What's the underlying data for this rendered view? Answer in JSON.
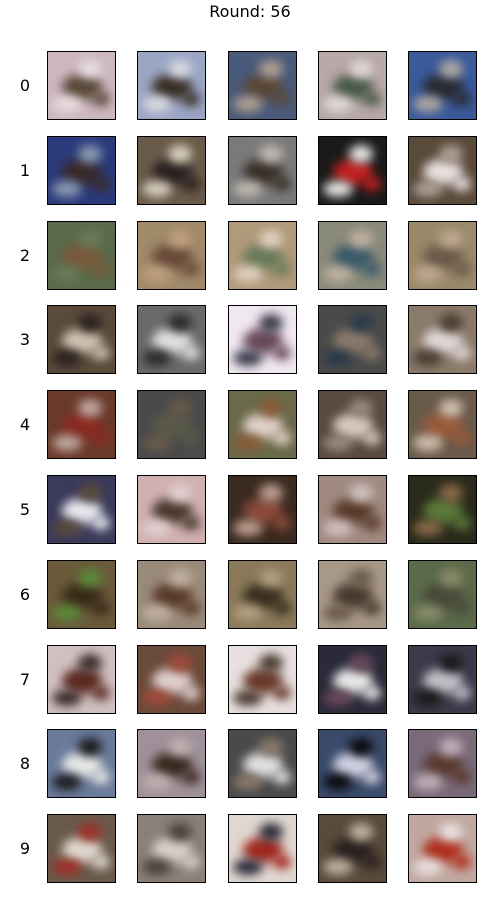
{
  "title": "Round: 56",
  "row_labels": [
    "0",
    "1",
    "2",
    "3",
    "4",
    "5",
    "6",
    "7",
    "8",
    "9"
  ],
  "grid": {
    "rows": 10,
    "cols": 5
  },
  "tiles": [
    [
      {
        "bg": "#cdb8c0",
        "fg": "#5a4a3a",
        "accent": "#e8dde0"
      },
      {
        "bg": "#9aa6c4",
        "fg": "#3a3028",
        "accent": "#d8d8e0"
      },
      {
        "bg": "#4a5a7a",
        "fg": "#5a4838",
        "accent": "#b0a090"
      },
      {
        "bg": "#b8a8a8",
        "fg": "#4a5a48",
        "accent": "#e0d8d8"
      },
      {
        "bg": "#3a5a9a",
        "fg": "#2a2a30",
        "accent": "#b0a8a0"
      }
    ],
    [
      {
        "bg": "#2a3a7a",
        "fg": "#3a2a2a",
        "accent": "#8a9ab0"
      },
      {
        "bg": "#6a5a4a",
        "fg": "#2a2020",
        "accent": "#d8d0c0"
      },
      {
        "bg": "#7a7a7a",
        "fg": "#3a3028",
        "accent": "#c0b8b0"
      },
      {
        "bg": "#1a1a1a",
        "fg": "#c02020",
        "accent": "#e8e8e8"
      },
      {
        "bg": "#5a4a3a",
        "fg": "#e8e0e0",
        "accent": "#b0a098"
      }
    ],
    [
      {
        "bg": "#5a6a4a",
        "fg": "#7a5a3a",
        "accent": "#6a7a5a"
      },
      {
        "bg": "#a08a6a",
        "fg": "#6a4a3a",
        "accent": "#c0a080"
      },
      {
        "bg": "#b09a7a",
        "fg": "#6a7a5a",
        "accent": "#e0d0c0"
      },
      {
        "bg": "#8a8a7a",
        "fg": "#3a5a6a",
        "accent": "#c0b0a0"
      },
      {
        "bg": "#9a8a6a",
        "fg": "#6a5a4a",
        "accent": "#c0a890"
      }
    ],
    [
      {
        "bg": "#5a4a3a",
        "fg": "#d0c0b0",
        "accent": "#2a2020"
      },
      {
        "bg": "#6a6a6a",
        "fg": "#e0e0e0",
        "accent": "#2a2a2a"
      },
      {
        "bg": "#f0e8f0",
        "fg": "#6a4a5a",
        "accent": "#3a3a4a"
      },
      {
        "bg": "#4a4a4a",
        "fg": "#8a7a6a",
        "accent": "#2a3a4a"
      },
      {
        "bg": "#8a7a6a",
        "fg": "#e0d8d8",
        "accent": "#4a3a30"
      }
    ],
    [
      {
        "bg": "#6a3a2a",
        "fg": "#8a2a20",
        "accent": "#c0a8a0"
      },
      {
        "bg": "#4a4a4a",
        "fg": "#5a5a4a",
        "accent": "#6a5a4a"
      },
      {
        "bg": "#6a6a4a",
        "fg": "#e0d0c8",
        "accent": "#8a5a3a"
      },
      {
        "bg": "#5a4a40",
        "fg": "#d8c8c0",
        "accent": "#9a8a80"
      },
      {
        "bg": "#6a5a4a",
        "fg": "#9a5a3a",
        "accent": "#d0c0b0"
      }
    ],
    [
      {
        "bg": "#3a3a5a",
        "fg": "#e8e8f0",
        "accent": "#5a4a3a"
      },
      {
        "bg": "#d0b0b0",
        "fg": "#4a3a30",
        "accent": "#e0d0d0"
      },
      {
        "bg": "#3a2a20",
        "fg": "#8a4a3a",
        "accent": "#c0a090"
      },
      {
        "bg": "#a08a80",
        "fg": "#5a3a2a",
        "accent": "#d0c0c0"
      },
      {
        "bg": "#2a2a1a",
        "fg": "#5a7a3a",
        "accent": "#8a6a4a"
      }
    ],
    [
      {
        "bg": "#6a5a3a",
        "fg": "#3a2a1a",
        "accent": "#5a8a3a"
      },
      {
        "bg": "#9a8a7a",
        "fg": "#5a3a2a",
        "accent": "#c0b0a0"
      },
      {
        "bg": "#8a7a5a",
        "fg": "#3a3020",
        "accent": "#b0a080"
      },
      {
        "bg": "#a89888",
        "fg": "#4a3a30",
        "accent": "#6a5a4a"
      },
      {
        "bg": "#5a6a4a",
        "fg": "#4a4a3a",
        "accent": "#8a8a6a"
      }
    ],
    [
      {
        "bg": "#d0c0c0",
        "fg": "#5a2a20",
        "accent": "#3a2a2a"
      },
      {
        "bg": "#6a4a3a",
        "fg": "#e0d0d0",
        "accent": "#a04a3a"
      },
      {
        "bg": "#e8e0e0",
        "fg": "#6a3a2a",
        "accent": "#4a3a30"
      },
      {
        "bg": "#2a2a3a",
        "fg": "#e8e8e8",
        "accent": "#6a4a5a"
      },
      {
        "bg": "#3a3a4a",
        "fg": "#c0c0c8",
        "accent": "#1a1a1a"
      }
    ],
    [
      {
        "bg": "#6a7a9a",
        "fg": "#e8e8e8",
        "accent": "#1a1a1a"
      },
      {
        "bg": "#a0909a",
        "fg": "#3a2a20",
        "accent": "#c0b0b0"
      },
      {
        "bg": "#4a4a4a",
        "fg": "#e0e0e0",
        "accent": "#8a7a6a"
      },
      {
        "bg": "#3a4a6a",
        "fg": "#d0d0e0",
        "accent": "#0a0a0a"
      },
      {
        "bg": "#7a6a7a",
        "fg": "#5a3a30",
        "accent": "#c0b0b8"
      }
    ],
    [
      {
        "bg": "#6a5a4a",
        "fg": "#e0d8d0",
        "accent": "#a03028"
      },
      {
        "bg": "#8a8078",
        "fg": "#d8d0c8",
        "accent": "#4a4038"
      },
      {
        "bg": "#e0d8d0",
        "fg": "#a02820",
        "accent": "#2a2a3a"
      },
      {
        "bg": "#5a4a3a",
        "fg": "#2a2020",
        "accent": "#c0b0a0"
      },
      {
        "bg": "#c0a8a0",
        "fg": "#b03020",
        "accent": "#e8e0e0"
      }
    ]
  ]
}
